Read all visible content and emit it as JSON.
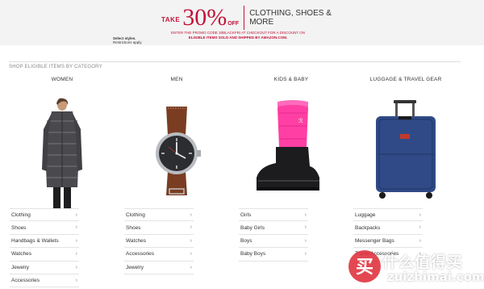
{
  "banner": {
    "take": "TAKE",
    "percent": "30%",
    "off": "OFF",
    "headline": "CLOTHING, SHOES & MORE",
    "promo_line1": "ENTER THE PROMO CODE 30BLACKFRI AT CHECKOUT FOR A DISCOUNT ON",
    "promo_line2": "ELIGIBLE ITEMS SOLD AND SHIPPED BY AMAZON.COM.",
    "select_styles": "Select styles.",
    "restrictions": "Restrictions apply."
  },
  "section": {
    "title": "SHOP ELIGIBLE ITEMS BY CATEGORY"
  },
  "categories": [
    {
      "title": "WOMEN",
      "image": "puffer-jacket",
      "items": [
        "Clothing",
        "Shoes",
        "Handbags & Wallets",
        "Watches",
        "Jewelry",
        "Accessories"
      ]
    },
    {
      "title": "MEN",
      "image": "wristwatch",
      "items": [
        "Clothing",
        "Shoes",
        "Watches",
        "Accessories",
        "Jewelry"
      ]
    },
    {
      "title": "KIDS & BABY",
      "image": "snow-boot",
      "items": [
        "Girls",
        "Baby Girls",
        "Boys",
        "Baby Boys"
      ]
    },
    {
      "title": "LUGGAGE & TRAVEL GEAR",
      "image": "rolling-suitcase",
      "items": [
        "Luggage",
        "Backpacks",
        "Messenger Bags",
        "Travel Accessories"
      ]
    }
  ],
  "watermark": {
    "icon": "zhi-badge-icon",
    "cn": "什么值得买",
    "en": "zuizhimai.com"
  },
  "colors": {
    "accent_red": "#c2143a",
    "banner_bg": "#f3f3f3",
    "watermark_red": "#e0343f"
  }
}
